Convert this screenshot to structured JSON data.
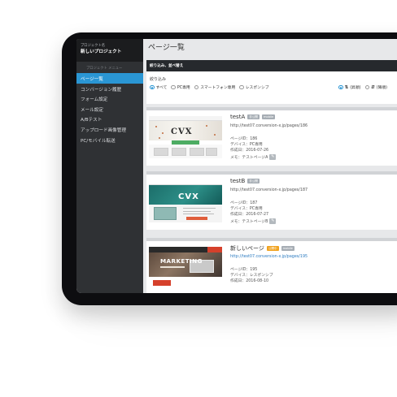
{
  "sidebar": {
    "project_sub": "プロジェクト名",
    "project_name": "新しいプロジェクト",
    "section_label": "プロジェクト メニュー",
    "items": [
      {
        "label": "ページ一覧"
      },
      {
        "label": "コンバージョン履歴"
      },
      {
        "label": "フォーム設定"
      },
      {
        "label": "メール設定"
      },
      {
        "label": "A/Bテスト"
      },
      {
        "label": "アップロード画像管理"
      },
      {
        "label": "PC/モバイル転送"
      }
    ]
  },
  "main": {
    "title": "ページ一覧",
    "filter": {
      "header": "絞り込み、並べ替え",
      "label": "絞り込み",
      "options": [
        {
          "label": "すべて",
          "selected": true
        },
        {
          "label": "PC専用",
          "selected": false
        },
        {
          "label": "スマートフォン専用",
          "selected": false
        },
        {
          "label": "レスポンシブ",
          "selected": false
        }
      ],
      "sort": [
        {
          "icon": "sort-desc-icon",
          "label": "(昇順)",
          "selected": true
        },
        {
          "icon": "sort-asc-icon",
          "label": "(降順)",
          "selected": false
        }
      ]
    },
    "pages": [
      {
        "title": "testA",
        "badges": [
          {
            "text": "非公開",
            "color": "#a6adb4"
          },
          {
            "text": "mobile",
            "color": "#a6adb4"
          }
        ],
        "url": "http://test07.conversion-x.jp/pages/186",
        "page_id": "ページID：186",
        "device": "デバイス：PC専用",
        "created": "作成日：2016-07-26",
        "memo": "メモ：テストページA"
      },
      {
        "title": "testB",
        "badges": [
          {
            "text": "非公開",
            "color": "#a6adb4"
          }
        ],
        "url": "http://test07.conversion-x.jp/pages/187",
        "page_id": "ページID：187",
        "device": "デバイス：PC専用",
        "created": "作成日：2016-07-27",
        "memo": "メモ：テストページB"
      },
      {
        "title": "新しいページ",
        "badges": [
          {
            "text": "公開中",
            "color": "#f0a11c"
          },
          {
            "text": "mobile",
            "color": "#a6adb4"
          }
        ],
        "url": "http://test07.conversion-x.jp/pages/195",
        "page_id": "ページID：195",
        "device": "デバイス：レスポンシブ",
        "created": "作成日：2016-08-10",
        "memo": ""
      }
    ],
    "thumb_text": {
      "cvx": "CVX",
      "marketing": "MARKETING"
    }
  }
}
